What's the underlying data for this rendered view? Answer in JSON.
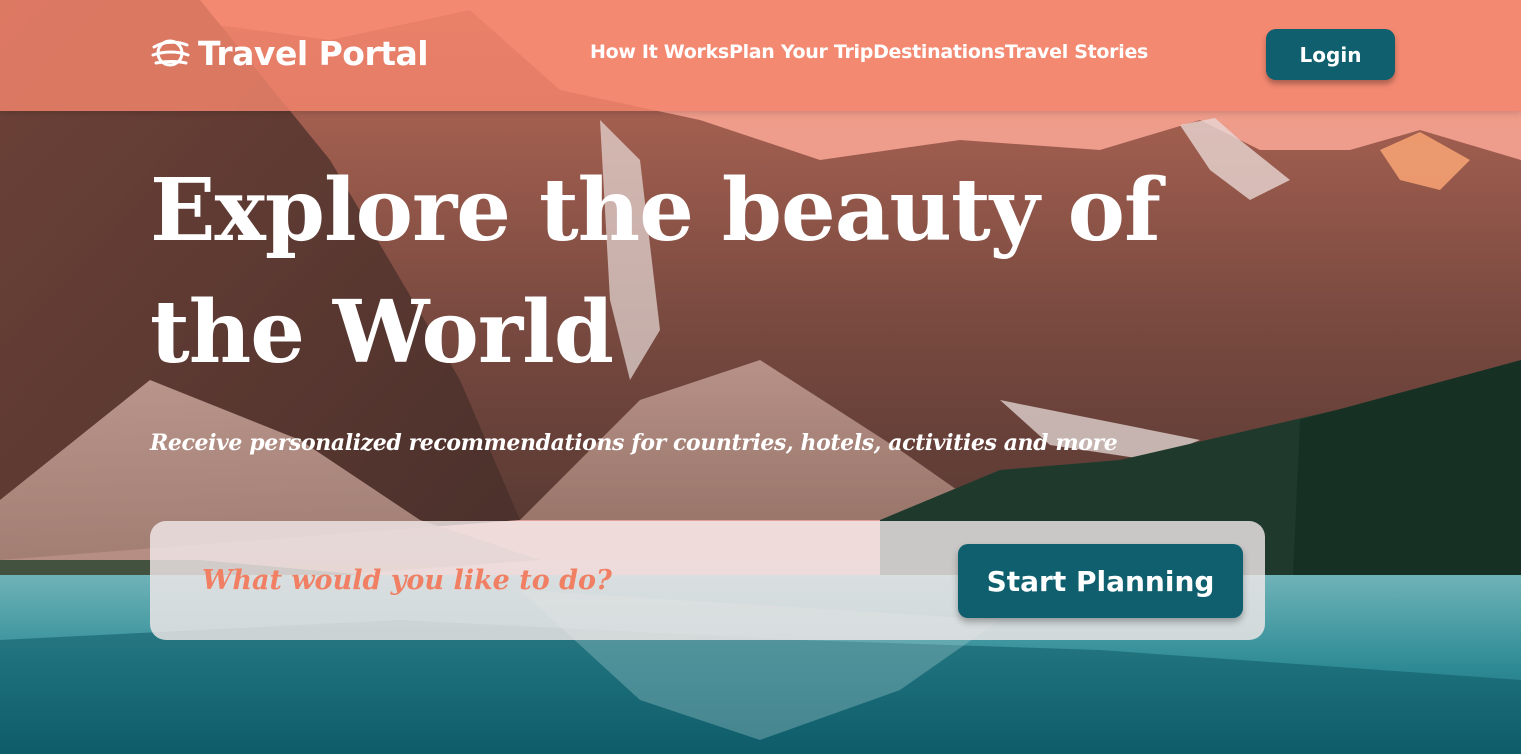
{
  "brand": {
    "name": "Travel Portal",
    "icon": "globe-swirl-icon"
  },
  "nav": {
    "items": [
      {
        "label": "How It Works"
      },
      {
        "label": "Plan Your Trip"
      },
      {
        "label": "Destinations"
      },
      {
        "label": "Travel Stories"
      }
    ]
  },
  "header": {
    "login_label": "Login"
  },
  "hero": {
    "headline": "Explore the beauty of the World",
    "subheadline": "Receive personalized recommendations for countries, hotels, activities and more",
    "background": "mountain-lake-photo"
  },
  "search": {
    "placeholder": "What would you like to do?",
    "value": "",
    "button_label": "Start Planning"
  },
  "colors": {
    "header_bg": "#f4856c",
    "accent": "#0f5f6e",
    "placeholder": "#f07f63",
    "text_light": "#ffffff"
  }
}
